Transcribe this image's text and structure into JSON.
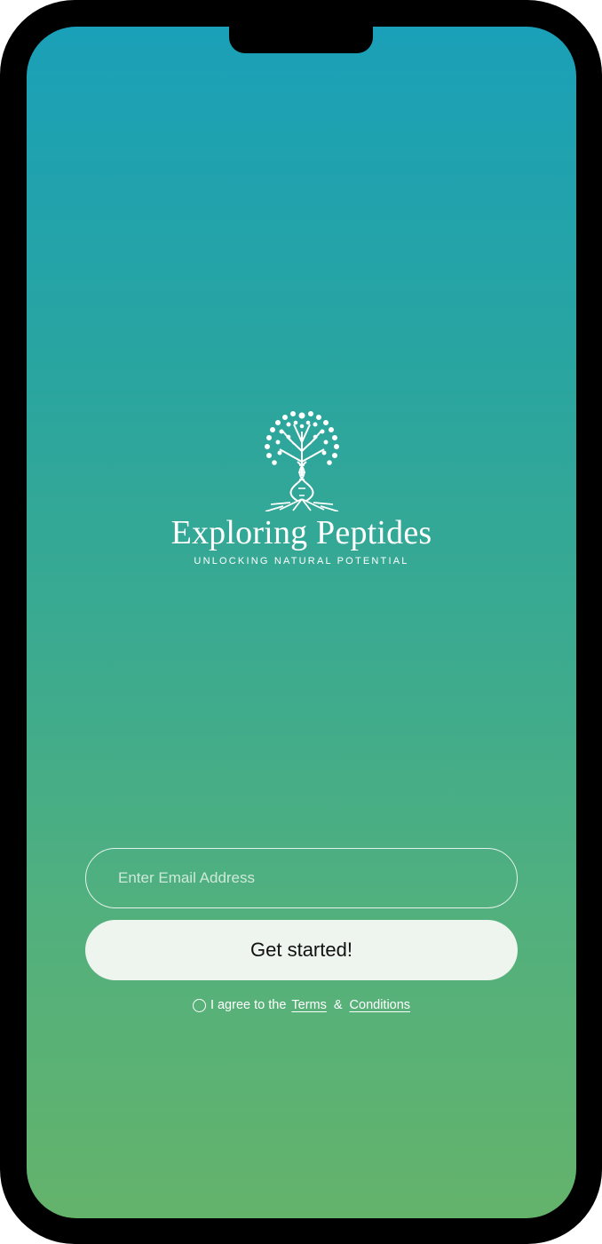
{
  "brand": {
    "logo_icon": "tree-dna-logo-icon",
    "name": "Exploring Peptides",
    "tagline": "UNLOCKING NATURAL POTENTIAL"
  },
  "form": {
    "email_placeholder": "Enter Email Address",
    "email_value": "",
    "submit_label": "Get started!"
  },
  "agreement": {
    "checkbox_icon": "radio-circle-icon",
    "prefix": "I agree to the",
    "terms_link": "Terms",
    "separator": "&",
    "conditions_link": "Conditions"
  },
  "colors": {
    "gradient_top": "#1aa0b8",
    "gradient_bottom": "#64b36b",
    "button_bg": "#eef4ee",
    "device_frame": "#000000"
  }
}
